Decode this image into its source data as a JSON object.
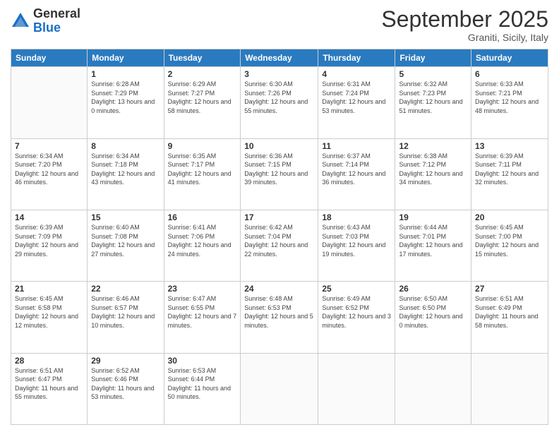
{
  "header": {
    "logo": {
      "general": "General",
      "blue": "Blue"
    },
    "month": "September 2025",
    "location": "Graniti, Sicily, Italy"
  },
  "days_of_week": [
    "Sunday",
    "Monday",
    "Tuesday",
    "Wednesday",
    "Thursday",
    "Friday",
    "Saturday"
  ],
  "weeks": [
    [
      {
        "day": "",
        "sunrise": "",
        "sunset": "",
        "daylight": ""
      },
      {
        "day": "1",
        "sunrise": "Sunrise: 6:28 AM",
        "sunset": "Sunset: 7:29 PM",
        "daylight": "Daylight: 13 hours and 0 minutes."
      },
      {
        "day": "2",
        "sunrise": "Sunrise: 6:29 AM",
        "sunset": "Sunset: 7:27 PM",
        "daylight": "Daylight: 12 hours and 58 minutes."
      },
      {
        "day": "3",
        "sunrise": "Sunrise: 6:30 AM",
        "sunset": "Sunset: 7:26 PM",
        "daylight": "Daylight: 12 hours and 55 minutes."
      },
      {
        "day": "4",
        "sunrise": "Sunrise: 6:31 AM",
        "sunset": "Sunset: 7:24 PM",
        "daylight": "Daylight: 12 hours and 53 minutes."
      },
      {
        "day": "5",
        "sunrise": "Sunrise: 6:32 AM",
        "sunset": "Sunset: 7:23 PM",
        "daylight": "Daylight: 12 hours and 51 minutes."
      },
      {
        "day": "6",
        "sunrise": "Sunrise: 6:33 AM",
        "sunset": "Sunset: 7:21 PM",
        "daylight": "Daylight: 12 hours and 48 minutes."
      }
    ],
    [
      {
        "day": "7",
        "sunrise": "Sunrise: 6:34 AM",
        "sunset": "Sunset: 7:20 PM",
        "daylight": "Daylight: 12 hours and 46 minutes."
      },
      {
        "day": "8",
        "sunrise": "Sunrise: 6:34 AM",
        "sunset": "Sunset: 7:18 PM",
        "daylight": "Daylight: 12 hours and 43 minutes."
      },
      {
        "day": "9",
        "sunrise": "Sunrise: 6:35 AM",
        "sunset": "Sunset: 7:17 PM",
        "daylight": "Daylight: 12 hours and 41 minutes."
      },
      {
        "day": "10",
        "sunrise": "Sunrise: 6:36 AM",
        "sunset": "Sunset: 7:15 PM",
        "daylight": "Daylight: 12 hours and 39 minutes."
      },
      {
        "day": "11",
        "sunrise": "Sunrise: 6:37 AM",
        "sunset": "Sunset: 7:14 PM",
        "daylight": "Daylight: 12 hours and 36 minutes."
      },
      {
        "day": "12",
        "sunrise": "Sunrise: 6:38 AM",
        "sunset": "Sunset: 7:12 PM",
        "daylight": "Daylight: 12 hours and 34 minutes."
      },
      {
        "day": "13",
        "sunrise": "Sunrise: 6:39 AM",
        "sunset": "Sunset: 7:11 PM",
        "daylight": "Daylight: 12 hours and 32 minutes."
      }
    ],
    [
      {
        "day": "14",
        "sunrise": "Sunrise: 6:39 AM",
        "sunset": "Sunset: 7:09 PM",
        "daylight": "Daylight: 12 hours and 29 minutes."
      },
      {
        "day": "15",
        "sunrise": "Sunrise: 6:40 AM",
        "sunset": "Sunset: 7:08 PM",
        "daylight": "Daylight: 12 hours and 27 minutes."
      },
      {
        "day": "16",
        "sunrise": "Sunrise: 6:41 AM",
        "sunset": "Sunset: 7:06 PM",
        "daylight": "Daylight: 12 hours and 24 minutes."
      },
      {
        "day": "17",
        "sunrise": "Sunrise: 6:42 AM",
        "sunset": "Sunset: 7:04 PM",
        "daylight": "Daylight: 12 hours and 22 minutes."
      },
      {
        "day": "18",
        "sunrise": "Sunrise: 6:43 AM",
        "sunset": "Sunset: 7:03 PM",
        "daylight": "Daylight: 12 hours and 19 minutes."
      },
      {
        "day": "19",
        "sunrise": "Sunrise: 6:44 AM",
        "sunset": "Sunset: 7:01 PM",
        "daylight": "Daylight: 12 hours and 17 minutes."
      },
      {
        "day": "20",
        "sunrise": "Sunrise: 6:45 AM",
        "sunset": "Sunset: 7:00 PM",
        "daylight": "Daylight: 12 hours and 15 minutes."
      }
    ],
    [
      {
        "day": "21",
        "sunrise": "Sunrise: 6:45 AM",
        "sunset": "Sunset: 6:58 PM",
        "daylight": "Daylight: 12 hours and 12 minutes."
      },
      {
        "day": "22",
        "sunrise": "Sunrise: 6:46 AM",
        "sunset": "Sunset: 6:57 PM",
        "daylight": "Daylight: 12 hours and 10 minutes."
      },
      {
        "day": "23",
        "sunrise": "Sunrise: 6:47 AM",
        "sunset": "Sunset: 6:55 PM",
        "daylight": "Daylight: 12 hours and 7 minutes."
      },
      {
        "day": "24",
        "sunrise": "Sunrise: 6:48 AM",
        "sunset": "Sunset: 6:53 PM",
        "daylight": "Daylight: 12 hours and 5 minutes."
      },
      {
        "day": "25",
        "sunrise": "Sunrise: 6:49 AM",
        "sunset": "Sunset: 6:52 PM",
        "daylight": "Daylight: 12 hours and 3 minutes."
      },
      {
        "day": "26",
        "sunrise": "Sunrise: 6:50 AM",
        "sunset": "Sunset: 6:50 PM",
        "daylight": "Daylight: 12 hours and 0 minutes."
      },
      {
        "day": "27",
        "sunrise": "Sunrise: 6:51 AM",
        "sunset": "Sunset: 6:49 PM",
        "daylight": "Daylight: 11 hours and 58 minutes."
      }
    ],
    [
      {
        "day": "28",
        "sunrise": "Sunrise: 6:51 AM",
        "sunset": "Sunset: 6:47 PM",
        "daylight": "Daylight: 11 hours and 55 minutes."
      },
      {
        "day": "29",
        "sunrise": "Sunrise: 6:52 AM",
        "sunset": "Sunset: 6:46 PM",
        "daylight": "Daylight: 11 hours and 53 minutes."
      },
      {
        "day": "30",
        "sunrise": "Sunrise: 6:53 AM",
        "sunset": "Sunset: 6:44 PM",
        "daylight": "Daylight: 11 hours and 50 minutes."
      },
      {
        "day": "",
        "sunrise": "",
        "sunset": "",
        "daylight": ""
      },
      {
        "day": "",
        "sunrise": "",
        "sunset": "",
        "daylight": ""
      },
      {
        "day": "",
        "sunrise": "",
        "sunset": "",
        "daylight": ""
      },
      {
        "day": "",
        "sunrise": "",
        "sunset": "",
        "daylight": ""
      }
    ]
  ]
}
